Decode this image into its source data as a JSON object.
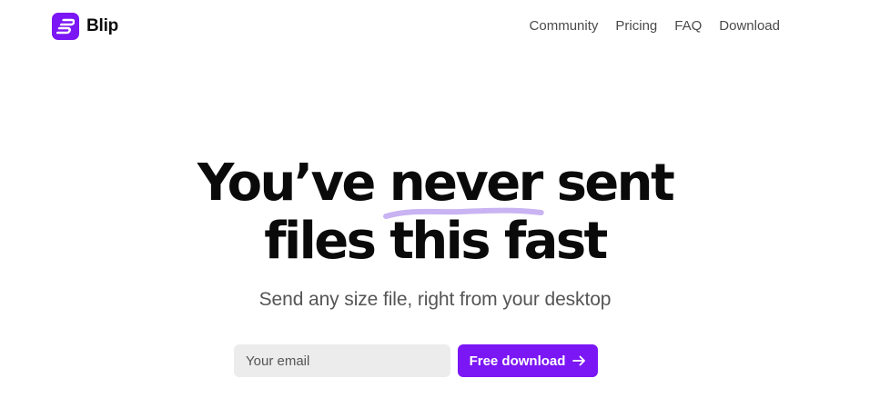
{
  "brand": {
    "name": "Blip",
    "color": "#7b16f5",
    "logo_icon": "blip-logo-icon"
  },
  "nav": {
    "items": [
      {
        "label": "Community"
      },
      {
        "label": "Pricing"
      },
      {
        "label": "FAQ"
      },
      {
        "label": "Download"
      }
    ]
  },
  "hero": {
    "headline_before": "You’ve",
    "headline_accent": "never",
    "headline_after": "sent",
    "headline_line2": "files this fast",
    "subheadline": "Send any size file, right from your desktop",
    "accent_underline_color": "#c9b3f2"
  },
  "signup": {
    "email_placeholder": "Your email",
    "button_label": "Free download",
    "button_icon": "arrow-right-icon"
  }
}
